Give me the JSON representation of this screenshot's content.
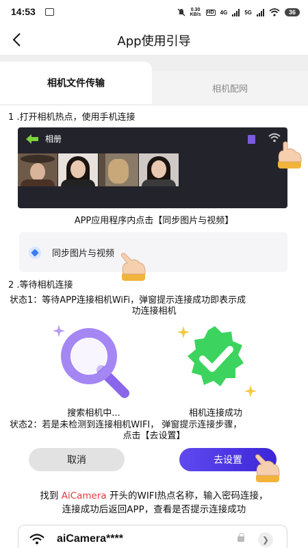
{
  "status_bar": {
    "time": "14:53",
    "net_speed_value": "0.30",
    "net_speed_unit": "KB/s",
    "hd_label": "HD",
    "net_4g": "4G",
    "net_5g": "5G",
    "battery": "36"
  },
  "header": {
    "title": "App使用引导"
  },
  "tabs": [
    {
      "label": "相机文件传输",
      "active": true
    },
    {
      "label": "相机配网",
      "active": false
    }
  ],
  "step1": {
    "title": "1 .打开相机热点，使用手机连接",
    "gallery_title": "相册",
    "caption": "APP应用程序内点击【同步图片与视频】",
    "sync_label": "同步图片与视频"
  },
  "step2": {
    "title": "2 .等待相机连接",
    "state1_line1": "状态1：等待APP连接相机WiFi，弹窗提示连接成功即表示成",
    "state1_line2": "功连接相机",
    "searching_label": "搜索相机中...",
    "success_label": "相机连接成功",
    "state2_line1": "状态2：若是未检测到连接相机WIFI，  弹窗提示连接步骤，",
    "state2_line2": "点击【去设置】",
    "cancel_label": "取消",
    "settings_label": "去设置"
  },
  "hotspot": {
    "prefix": "找到 ",
    "brand": "AiCamera",
    "suffix": " 开头的WIFI热点名称，输入密码连接，",
    "line2": "连接成功后返回APP，查看是否提示连接成功",
    "wifi_name": "aiCamera****"
  },
  "colors": {
    "accent": "#4a33e6",
    "brand_red": "#e23a3a",
    "success_green": "#2fcf52",
    "search_purple": "#9b7bf2"
  }
}
